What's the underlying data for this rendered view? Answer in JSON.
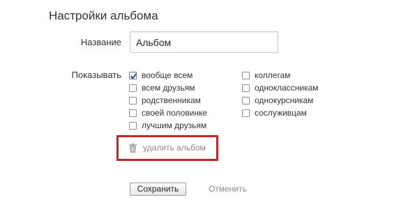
{
  "title": "Настройки альбома",
  "name_field": {
    "label": "Название",
    "value": "Альбом"
  },
  "visibility": {
    "label": "Показывать",
    "left_options": [
      {
        "label": "вообще всем",
        "checked": true
      },
      {
        "label": "всем друзьям",
        "checked": false
      },
      {
        "label": "родственникам",
        "checked": false
      },
      {
        "label": "своей половинке",
        "checked": false
      },
      {
        "label": "лучшим друзьям",
        "checked": false
      }
    ],
    "right_options": [
      {
        "label": "коллегам",
        "checked": false
      },
      {
        "label": "одноклассникам",
        "checked": false
      },
      {
        "label": "однокурсникам",
        "checked": false
      },
      {
        "label": "сослуживцам",
        "checked": false
      }
    ]
  },
  "delete": {
    "label": "удалить альбом",
    "icon": "trash-icon",
    "highlight_color": "#c0272d"
  },
  "actions": {
    "save_label": "Сохранить",
    "cancel_label": "Отменить"
  }
}
